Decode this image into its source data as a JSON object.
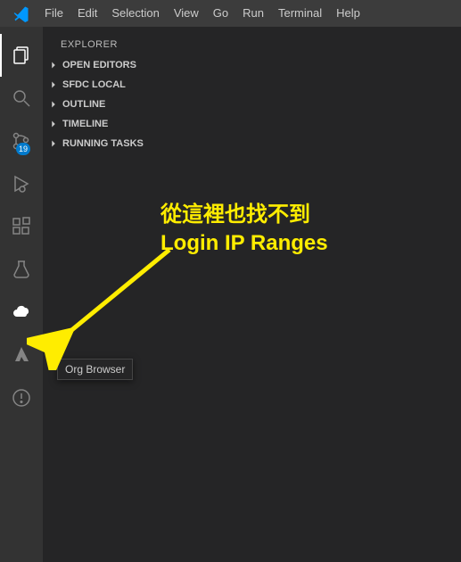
{
  "menubar": {
    "items": [
      "File",
      "Edit",
      "Selection",
      "View",
      "Go",
      "Run",
      "Terminal",
      "Help"
    ]
  },
  "activitybar": {
    "badge_count": "19",
    "icons": [
      "explorer-icon",
      "search-icon",
      "scm-icon",
      "run-icon",
      "extensions-icon",
      "test-icon",
      "cloud-icon",
      "azure-icon",
      "issues-icon"
    ]
  },
  "sidebar": {
    "title": "EXPLORER",
    "sections": [
      {
        "label": "OPEN EDITORS"
      },
      {
        "label": "SFDC LOCAL"
      },
      {
        "label": "OUTLINE"
      },
      {
        "label": "TIMELINE"
      },
      {
        "label": "RUNNING TASKS"
      }
    ]
  },
  "tooltip": {
    "label": "Org Browser"
  },
  "annotation": {
    "line1": "從這裡也找不到",
    "line2": "Login IP Ranges"
  },
  "colors": {
    "accent_yellow": "#ffed00",
    "badge_bg": "#007acc"
  }
}
